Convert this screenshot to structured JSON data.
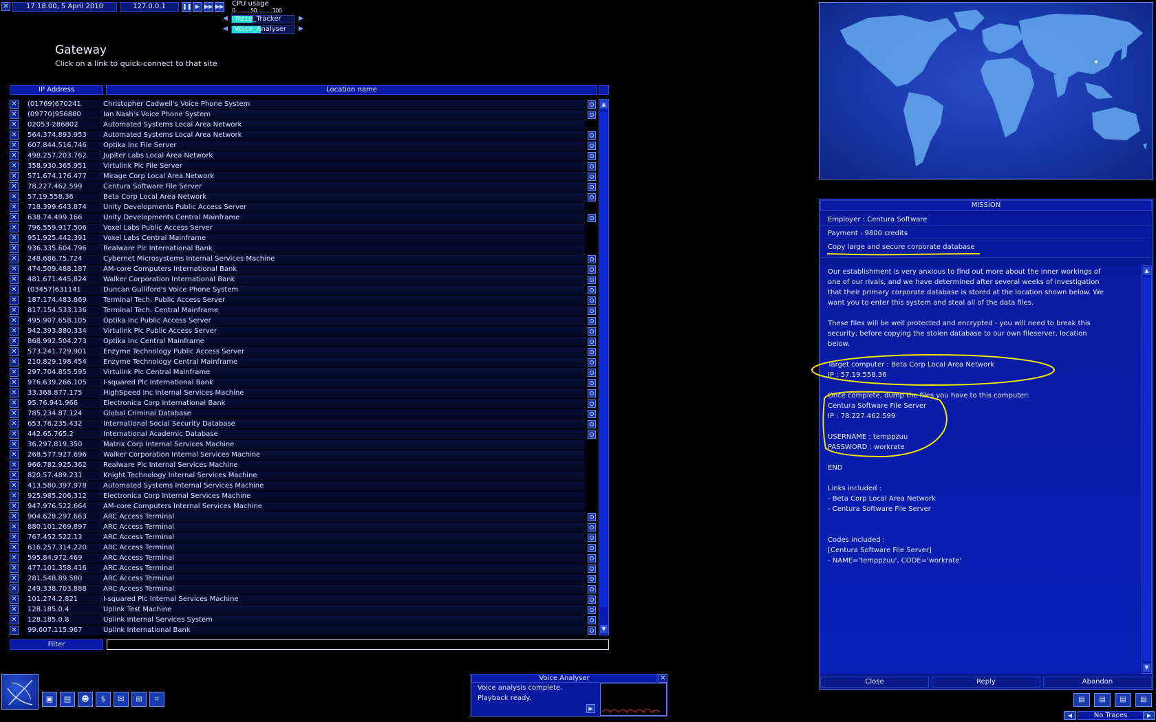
{
  "top_bar": {
    "datetime": "17.18.00, 5 April 2010",
    "localhost": "127.0.0.1",
    "cpu_title": "CPU usage",
    "cpu_scale": "0...........50...........100",
    "tasks": [
      {
        "name": "Trace_Tracker"
      },
      {
        "name": "Voice_Analyser"
      }
    ],
    "playback_buttons": [
      "pause",
      "play",
      "fast",
      "fastest"
    ]
  },
  "gateway": {
    "title": "Gateway",
    "subtitle": "Click on a link to quick-connect to that site",
    "col_ip": "IP Address",
    "col_location": "Location name",
    "filter_label": "Filter",
    "filter_value": "",
    "rows": [
      {
        "ip": "(01769)670241",
        "location": "Christopher Cadwell's Voice Phone System",
        "icon": true
      },
      {
        "ip": "(09770)956880",
        "location": "Ian Nash's Voice Phone System",
        "icon": true
      },
      {
        "ip": "02053-286802",
        "location": "Automated Systems Local Area Network",
        "icon": false
      },
      {
        "ip": "564.374.893.953",
        "location": "Automated Systems Local Area Network",
        "icon": true
      },
      {
        "ip": "607.844.516.746",
        "location": "Optika Inc File Server",
        "icon": true
      },
      {
        "ip": "498.257.203.762",
        "location": "Jupiter Labs Local Area Network",
        "icon": true
      },
      {
        "ip": "358.930.365.951",
        "location": "Virtulink Plc File Server",
        "icon": true
      },
      {
        "ip": "571.674.176.477",
        "location": "Mirage Corp Local Area Network",
        "icon": true
      },
      {
        "ip": "78.227.462.599",
        "location": "Centura Software File Server",
        "icon": true
      },
      {
        "ip": "57.19.558.36",
        "location": "Beta Corp Local Area Network",
        "icon": true
      },
      {
        "ip": "718.399.643.874",
        "location": "Unity Developments Public Access Server",
        "icon": false
      },
      {
        "ip": "638.74.499.166",
        "location": "Unity Developments Central Mainframe",
        "icon": true
      },
      {
        "ip": "796.559.917.506",
        "location": "Voxel Labs Public Access Server",
        "icon": false
      },
      {
        "ip": "951.925.442.391",
        "location": "Voxel Labs Central Mainframe",
        "icon": false
      },
      {
        "ip": "936.335.604.796",
        "location": "Realware Plc International Bank",
        "icon": false
      },
      {
        "ip": "248.686.75.724",
        "location": "Cybernet Microsystems Internal Services Machine",
        "icon": true
      },
      {
        "ip": "474.509.488.187",
        "location": "AM-core Computers International Bank",
        "icon": true
      },
      {
        "ip": "481.671.445.824",
        "location": "Walker Corporation International Bank",
        "icon": true
      },
      {
        "ip": "(03457)631141",
        "location": "Duncan Gulliford's Voice Phone System",
        "icon": true
      },
      {
        "ip": "187.174.483.869",
        "location": "Terminal Tech. Public Access Server",
        "icon": true
      },
      {
        "ip": "817.154.533.136",
        "location": "Terminal Tech. Central Mainframe",
        "icon": true
      },
      {
        "ip": "495.907.658.105",
        "location": "Optika Inc Public Access Server",
        "icon": true
      },
      {
        "ip": "942.393.880.334",
        "location": "Virtulink Plc Public Access Server",
        "icon": true
      },
      {
        "ip": "868.992.504.273",
        "location": "Optika Inc Central Mainframe",
        "icon": true
      },
      {
        "ip": "573.241.729.901",
        "location": "Enzyme Technology Public Access Server",
        "icon": true
      },
      {
        "ip": "210.829.198.454",
        "location": "Enzyme Technology Central Mainframe",
        "icon": true
      },
      {
        "ip": "297.704.855.595",
        "location": "Virtulink Plc Central Mainframe",
        "icon": true
      },
      {
        "ip": "976.639.266.105",
        "location": "I-squared Plc International Bank",
        "icon": true
      },
      {
        "ip": "33.368.877.175",
        "location": "HighSpeed Inc Internal Services Machine",
        "icon": true
      },
      {
        "ip": "95.76.941.966",
        "location": "Electronica Corp International Bank",
        "icon": true
      },
      {
        "ip": "785.234.87.124",
        "location": "Global Criminal Database",
        "icon": true
      },
      {
        "ip": "653.76.235.432",
        "location": "International Social Security Database",
        "icon": true
      },
      {
        "ip": "442.65.765.2",
        "location": "International Academic Database",
        "icon": true
      },
      {
        "ip": "36.297.819.350",
        "location": "Matrix Corp Internal Services Machine",
        "icon": false
      },
      {
        "ip": "268.577.927.696",
        "location": "Walker Corporation Internal Services Machine",
        "icon": false
      },
      {
        "ip": "966.782.925.362",
        "location": "Realware Plc Internal Services Machine",
        "icon": false
      },
      {
        "ip": "820.57.489.231",
        "location": "Knight Technology Internal Services Machine",
        "icon": false
      },
      {
        "ip": "413.580.397.978",
        "location": "Automated Systems Internal Services Machine",
        "icon": false
      },
      {
        "ip": "925.985.206.312",
        "location": "Electronica Corp Internal Services Machine",
        "icon": false
      },
      {
        "ip": "947.976.522.664",
        "location": "AM-core Computers Internal Services Machine",
        "icon": false
      },
      {
        "ip": "904.628.297.663",
        "location": "ARC Access Terminal",
        "icon": true
      },
      {
        "ip": "880.101.269.897",
        "location": "ARC Access Terminal",
        "icon": true
      },
      {
        "ip": "767.452.522.13",
        "location": "ARC Access Terminal",
        "icon": true
      },
      {
        "ip": "616.257.314.220",
        "location": "ARC Access Terminal",
        "icon": true
      },
      {
        "ip": "595.84.972.469",
        "location": "ARC Access Terminal",
        "icon": true
      },
      {
        "ip": "477.101.358.416",
        "location": "ARC Access Terminal",
        "icon": true
      },
      {
        "ip": "281.548.89.580",
        "location": "ARC Access Terminal",
        "icon": true
      },
      {
        "ip": "249.338.703.888",
        "location": "ARC Access Terminal",
        "icon": true
      },
      {
        "ip": "101.274.2.821",
        "location": "I-squared Plc Internal Services Machine",
        "icon": true
      },
      {
        "ip": "128.185.0.4",
        "location": "Uplink Test Machine",
        "icon": true
      },
      {
        "ip": "128.185.0.8",
        "location": "Uplink Internal Services System",
        "icon": true
      },
      {
        "ip": "99.607.115.967",
        "location": "Uplink International Bank",
        "icon": true
      }
    ]
  },
  "mission": {
    "header": "MISSION",
    "employer": "Employer : Centura Software",
    "payment": "Payment : 9800 credits",
    "description": "Copy large and secure corporate database",
    "body_lines": [
      "Our establishment is very anxious to find out more about the inner workings of",
      "one of our rivals, and we have determined after several weeks of investigation",
      "that their primary corporate database is stored at the location shown below.  We",
      "want you to enter this system and steal all of the data files.",
      "",
      "These files will be well protected and encrypted - you will need to break this",
      "security, before copying the stolen database to our own fileserver, location",
      "below.",
      "",
      "Target computer : Beta Corp Local Area Network",
      "IP : 57.19.558.36",
      "",
      "Once complete, dump the files you have to this computer:",
      "Centura Software File Server",
      "IP : 78.227.462.599",
      "",
      "USERNAME : temppzuu",
      "PASSWORD : workrate",
      "",
      "END",
      "",
      "Links included :",
      "- Beta Corp Local Area Network",
      "- Centura Software File Server",
      "",
      "",
      "Codes included :",
      "[Centura Software File Server]",
      "- NAME='temppzuu', CODE='workrate'"
    ],
    "buttons": {
      "close": "Close",
      "reply": "Reply",
      "abandon": "Abandon"
    }
  },
  "voice_analyser": {
    "title": "Voice Analyser",
    "line1": "Voice analysis complete.",
    "line2": "Playback ready."
  },
  "status": {
    "traces": "No Traces"
  },
  "colors": {
    "panel_blue": "#0a1aa0",
    "highlight_yellow": "#f2e600",
    "task_cyan": "#20e0d0"
  }
}
